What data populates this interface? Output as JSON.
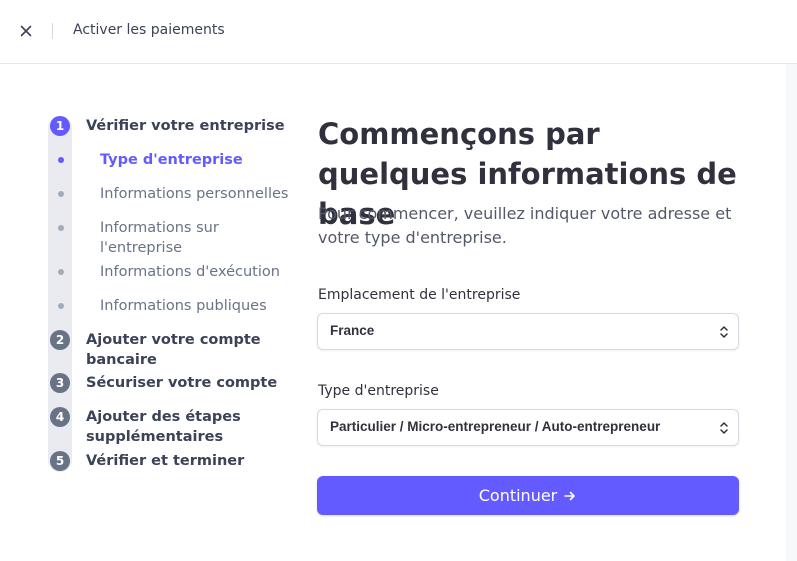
{
  "header": {
    "title": "Activer les paiements",
    "close_icon": "close-icon"
  },
  "stepper": {
    "steps": [
      {
        "number": "1",
        "label": "Vérifier votre entreprise",
        "state": "active"
      },
      {
        "number": "2",
        "label": "Ajouter votre compte bancaire",
        "state": "pending"
      },
      {
        "number": "3",
        "label": "Sécuriser votre compte",
        "state": "pending"
      },
      {
        "number": "4",
        "label": "Ajouter des étapes supplémentaires",
        "state": "pending"
      },
      {
        "number": "5",
        "label": "Vérifier et terminer",
        "state": "pending"
      }
    ],
    "substeps": [
      {
        "label": "Type d'entreprise",
        "state": "current"
      },
      {
        "label": "Informations personnelles",
        "state": "pending"
      },
      {
        "label": "Informations sur l'entreprise",
        "state": "pending"
      },
      {
        "label": "Informations d'exécution",
        "state": "pending"
      },
      {
        "label": "Informations publiques",
        "state": "pending"
      }
    ]
  },
  "main": {
    "heading": "Commençons par quelques informations de base",
    "description": "Pour commencer, veuillez indiquer votre adresse et votre type d'entreprise.",
    "location_field": {
      "label": "Emplacement de l'entreprise",
      "value": "France"
    },
    "type_field": {
      "label": "Type d'entreprise",
      "value": "Particulier / Micro-entrepreneur / Auto-entrepreneur"
    },
    "continue_button": "Continuer"
  },
  "colors": {
    "accent": "#635bff",
    "step_pending": "#697386",
    "text_primary": "#30313d"
  }
}
